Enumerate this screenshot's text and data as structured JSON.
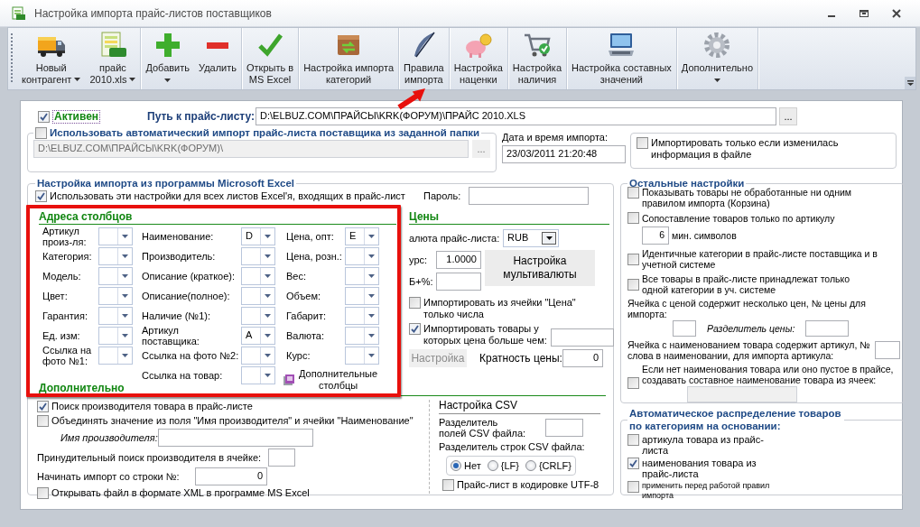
{
  "window": {
    "title": "Настройка импорта прайс-листов поставщиков"
  },
  "toolbar": [
    {
      "buttons": [
        {
          "label": "Новый\nконтрагент",
          "dropdown": true
        },
        {
          "label": "прайс\n2010.xls",
          "dropdown": true
        }
      ]
    },
    {
      "buttons": [
        {
          "label": "Добавить",
          "dropdown": true
        },
        {
          "label": "Удалить",
          "dropdown": false
        }
      ]
    },
    {
      "buttons": [
        {
          "label": "Открыть в\nMS Excel",
          "dropdown": false
        }
      ]
    },
    {
      "buttons": [
        {
          "label": "Настройка импорта\nкатегорий",
          "dropdown": false
        }
      ]
    },
    {
      "buttons": [
        {
          "label": "Правила\nимпорта",
          "dropdown": false
        }
      ]
    },
    {
      "buttons": [
        {
          "label": "Настройка\nнаценки",
          "dropdown": false
        }
      ]
    },
    {
      "buttons": [
        {
          "label": "Настройка\nналичия",
          "dropdown": false
        }
      ]
    },
    {
      "buttons": [
        {
          "label": "Настройка составных\nзначений",
          "dropdown": false
        }
      ]
    },
    {
      "buttons": [
        {
          "label": "Дополнительно",
          "dropdown": true
        }
      ]
    }
  ],
  "active": {
    "label": "Активен",
    "checked": true
  },
  "path": {
    "label": "Путь к прайс-листу:",
    "value": "D:\\ELBUZ.COM\\ПРАЙСЫ\\KRK(ФОРУМ)\\ПРАЙС  2010.XLS",
    "browse": "..."
  },
  "auto_import": {
    "label": "Использовать автоматический импорт прайс-листа поставщика из заданной папки",
    "checked": false,
    "folder": "D:\\ELBUZ.COM\\ПРАЙСЫ\\KRK(ФОРУМ)\\",
    "browse": "..."
  },
  "import_date": {
    "label": "Дата и время импорта:",
    "value": "23/03/2011 21:20:48"
  },
  "only_if_changed": {
    "label": "Импортировать только если изменилась информация в файле",
    "checked": false
  },
  "excel": {
    "title": "Настройка импорта из программы Microsoft Excel",
    "all_sheets": {
      "label": "Использовать эти настройки для всех листов Excel'я, входящих в прайс-лист",
      "checked": true
    },
    "password_label": "Пароль:",
    "addresses_title": "Адреса столбцов",
    "columns": [
      {
        "fields": [
          {
            "label": "Артикул\nпроиз-ля:"
          },
          {
            "label": "Категория:"
          },
          {
            "label": "Модель:"
          },
          {
            "label": "Цвет:"
          },
          {
            "label": "Гарантия:"
          },
          {
            "label": "Ед. изм:"
          },
          {
            "label": "Ссылка на\nфото №1:"
          }
        ]
      },
      {
        "fields": [
          {
            "label": "Наименование:",
            "value": "D"
          },
          {
            "label": "Производитель:"
          },
          {
            "label": "Описание (краткое):"
          },
          {
            "label": "Описание(полное):"
          },
          {
            "label": "Наличие (№1):"
          },
          {
            "label": "Артикул\nпоставщика:",
            "value": "A"
          },
          {
            "label": "Ссылка на фото №2:"
          },
          {
            "label": "Ссылка на товар:"
          }
        ]
      },
      {
        "fields": [
          {
            "label": "Цена, опт:",
            "value": "E"
          },
          {
            "label": "Цена, розн.:"
          },
          {
            "label": "Вес:"
          },
          {
            "label": "Объем:"
          },
          {
            "label": "Габарит:"
          },
          {
            "label": "Валюта:"
          },
          {
            "label": "Курс:"
          }
        ]
      }
    ],
    "extra_columns_button": "Дополнительные\nстолбцы",
    "prices": {
      "title": "Цены",
      "currency_label": "алюта прайс-листа:",
      "currency": "RUB",
      "rate_label": "урс:",
      "rate": "1.0000",
      "cb_label": "Б+%:",
      "multicurrency_button": "Настройка\nмультивалюты",
      "only_numbers": {
        "label": "Импортировать из ячейки \"Цена\"\nтолько числа",
        "checked": false
      },
      "min_price": {
        "label": "Импортировать товары у\nкоторых цена больше чем:",
        "checked": true
      },
      "settings_button": {
        "label": "Настройка",
        "disabled": true
      },
      "multiplicity_label": "Кратность цены:",
      "multiplicity": "0"
    },
    "additional": {
      "title": "Дополнительно",
      "find_maker": {
        "label": "Поиск производителя товара в прайс-листе",
        "checked": true
      },
      "merge": {
        "label": "Объединять значение из поля \"Имя производителя\" и ячейки \"Наименование\"",
        "checked": false
      },
      "maker_name_label": "Имя производителя:",
      "forced_label": "Принудительный поиск производителя в ячейке:",
      "start_row_label": "Начинать импорт со строки №:",
      "start_row": "0",
      "xml": {
        "label": "Открывать файл в формате XML в программе MS Excel",
        "checked": false
      }
    },
    "csv": {
      "title": "Настройка CSV",
      "field_sep_label": "Разделитель\nполей CSV файла:",
      "row_sep_label": "Разделитель строк CSV файла:",
      "row_sep_options": [
        {
          "label": "Нет",
          "selected": true
        },
        {
          "label": "{LF}",
          "selected": false
        },
        {
          "label": "{CRLF}",
          "selected": false
        }
      ],
      "utf8": {
        "label": "Прайс-лист в кодировке UTF-8",
        "checked": false
      }
    }
  },
  "other": {
    "title": "Остальные настройки",
    "show_unprocessed": {
      "label": "Показывать товары не обработанные ни одним правилом импорта (Корзина)",
      "checked": false
    },
    "match_by_sku": {
      "label": "Сопоставление товаров только по артикулу",
      "checked": false
    },
    "min_chars": "6",
    "min_chars_label": "мин. символов",
    "identical_categories": {
      "label": "Идентичные категории в прайс-листе поставщика и в учетной системе",
      "checked": false
    },
    "single_category": {
      "label": "Все товары в прайс-листе принадлежат только одной категории в уч. системе",
      "checked": false
    },
    "multi_price_label": "Ячейка с ценой содержит несколько цен, № цены для импорта:",
    "price_separator_label": "Разделитель цены:",
    "sku_in_name_label": "Ячейка с наименованием товара содержит артикул, № слова в наименовании, для импорта артикула:",
    "composite_name": {
      "label": "Если нет наименования товара или оно пустое в прайсе, создавать составное наименование товара из ячеек:",
      "checked": false
    }
  },
  "auto_distribution": {
    "title": "Автоматическое распределение товаров по категориям на основании:",
    "options": [
      {
        "label": "артикула товара из прайс-листа",
        "checked": false,
        "kind": "option"
      },
      {
        "label": "наименования товара из прайс-листа",
        "checked": true,
        "kind": "option"
      },
      {
        "label": "применить перед работой правил импорта",
        "checked": false,
        "kind": "note"
      }
    ]
  }
}
